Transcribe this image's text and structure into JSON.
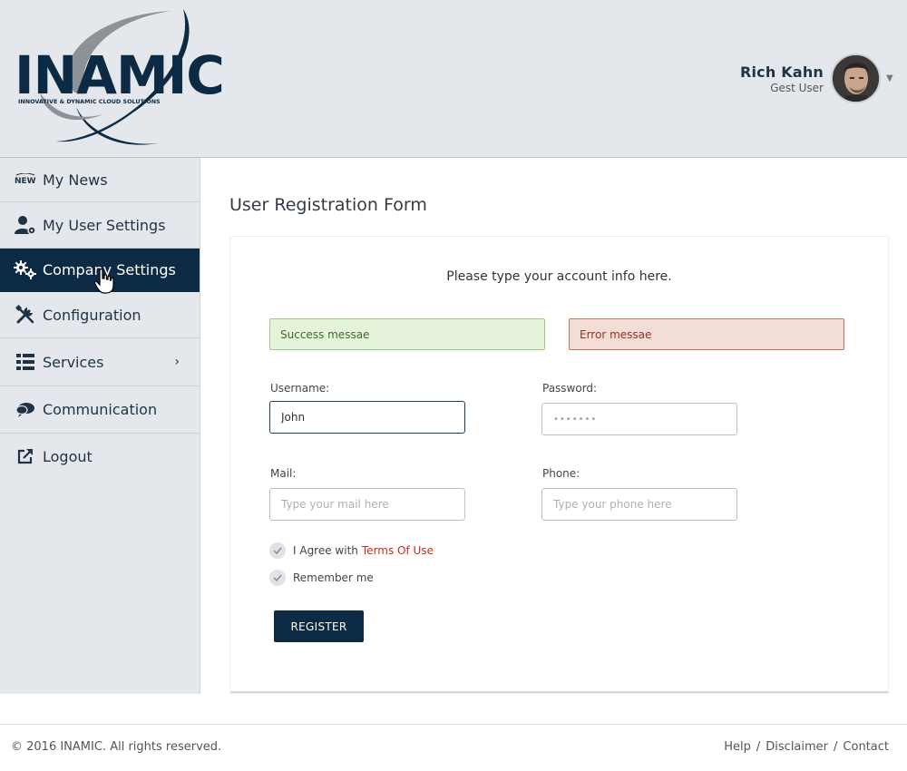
{
  "brand": {
    "logo_text": "INAMIC",
    "tagline": "INNOVATIVE & DYNAMIC CLOUD SOLUTIONS",
    "primary_color": "#0c2a44",
    "accent_color": "#cc2a1f"
  },
  "user": {
    "name": "Rich Kahn",
    "role": "Gest User"
  },
  "sidebar": {
    "items": [
      {
        "label": "My News",
        "icon": "news-icon"
      },
      {
        "label": "My User Settings",
        "icon": "user-settings-icon"
      },
      {
        "label": "Company Settings",
        "icon": "gears-icon",
        "active": true
      },
      {
        "label": "Configuration",
        "icon": "tools-icon"
      },
      {
        "label": "Services",
        "icon": "list-icon",
        "has_submenu": true
      },
      {
        "label": "Communication",
        "icon": "chat-icon"
      },
      {
        "label": "Logout",
        "icon": "logout-icon"
      }
    ]
  },
  "page": {
    "title": "User Registration Form"
  },
  "form": {
    "intro": "Please type your account info here.",
    "success_message": "Success messae",
    "error_message": "Error messae",
    "username": {
      "label": "Username:",
      "value": "John"
    },
    "password": {
      "label": "Password:",
      "value": "•••••••"
    },
    "mail": {
      "label": "Mail:",
      "placeholder": "Type your mail here"
    },
    "phone": {
      "label": "Phone:",
      "placeholder": "Type your phone here"
    },
    "agree": {
      "text": "I Agree with",
      "link": "Terms Of Use"
    },
    "remember": {
      "text": "Remember me"
    },
    "register_label": "REGISTER"
  },
  "footer": {
    "copyright": "© 2016 INAMIC. All rights reserved.",
    "links": [
      "Help",
      "Disclaimer",
      "Contact"
    ],
    "separator": "/"
  }
}
